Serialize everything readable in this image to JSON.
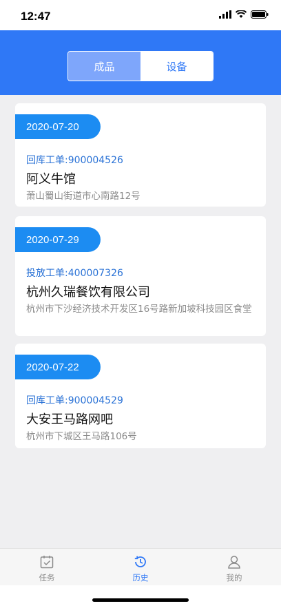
{
  "status": {
    "time": "12:47"
  },
  "segments": [
    {
      "label": "成品",
      "active": true
    },
    {
      "label": "设备",
      "active": false
    }
  ],
  "records": [
    {
      "date": "2020-07-20",
      "order": "回库工单:900004526",
      "name": "阿义牛馆",
      "address": "萧山蜀山街道市心南路12号"
    },
    {
      "date": "2020-07-29",
      "order": "投放工单:400007326",
      "name": "杭州久瑞餐饮有限公司",
      "address": "杭州市下沙经济技术开发区16号路新加坡科技园区食堂"
    },
    {
      "date": "2020-07-22",
      "order": "回库工单:900004529",
      "name": "大安王马路网吧",
      "address": "杭州市下城区王马路106号"
    }
  ],
  "tabbar": [
    {
      "label": "任务",
      "icon": "task-icon",
      "active": false
    },
    {
      "label": "历史",
      "icon": "history-icon",
      "active": true
    },
    {
      "label": "我的",
      "icon": "profile-icon",
      "active": false
    }
  ],
  "colors": {
    "primary": "#2f78f6",
    "date_pill": "#1c8cf2",
    "order_text": "#2a72d6"
  }
}
